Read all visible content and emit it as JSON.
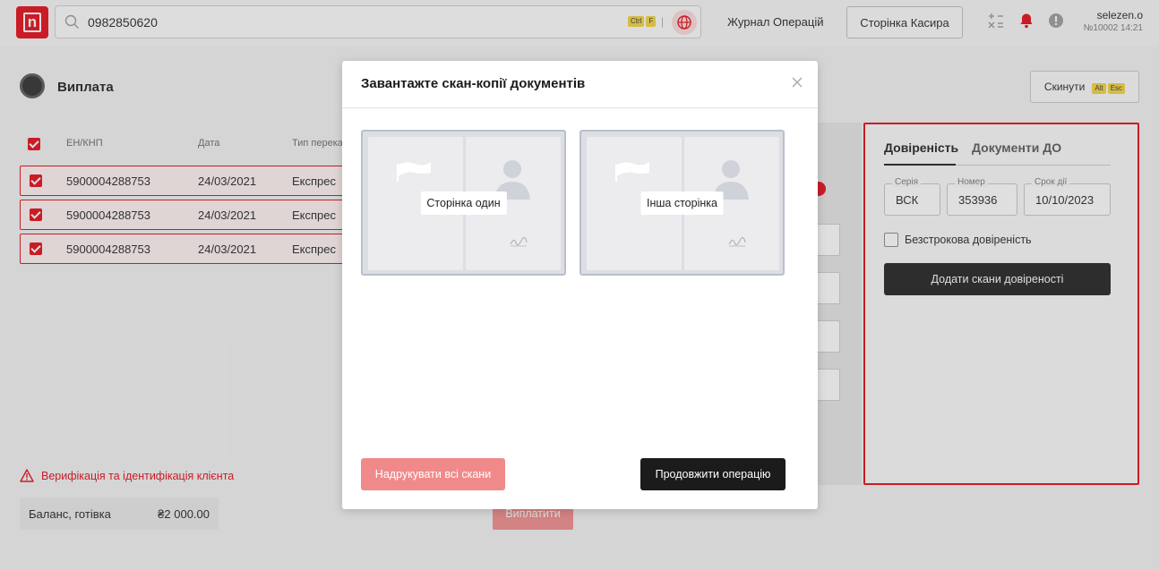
{
  "header": {
    "search_value": "0982850620",
    "shortcut_keys": [
      "Ctrl",
      "F"
    ],
    "journal_link": "Журнал Операцій",
    "cashier_button": "Сторінка Касира",
    "username": "selezen.o",
    "user_info": "№10002 14:21"
  },
  "page": {
    "title": "Виплата",
    "reset_button": "Скинути",
    "reset_keys": [
      "Alt",
      "Esc"
    ]
  },
  "table": {
    "headers": [
      "ЕН/КНП",
      "Дата",
      "Тип перека"
    ],
    "rows": [
      {
        "en": "5900004288753",
        "date": "24/03/2021",
        "type": "Експрес"
      },
      {
        "en": "5900004288753",
        "date": "24/03/2021",
        "type": "Експрес"
      },
      {
        "en": "5900004288753",
        "date": "24/03/2021",
        "type": "Експрес"
      }
    ]
  },
  "verification_warning": "Верифікація та ідентифікація клієнта",
  "balance": {
    "label": "Баланс, готівка",
    "value": "₴2 000.00"
  },
  "pay_button": "Виплатити",
  "power_of_attorney": {
    "tabs": [
      "Довіреність",
      "Документи ДО"
    ],
    "fields": [
      {
        "label": "Серія",
        "value": "ВСК"
      },
      {
        "label": "Номер",
        "value": "353936"
      },
      {
        "label": "Срок дії",
        "value": "10/10/2023"
      }
    ],
    "unlimited_label": "Безстрокова довіреність",
    "add_scans_button": "Додати скани довіреності"
  },
  "modal": {
    "title": "Завантажте скан-копії документів",
    "docs": [
      "Сторінка один",
      "Інша сторінка"
    ],
    "print_button": "Надрукувати всі скани",
    "continue_button": "Продовжити операцію"
  },
  "colors": {
    "accent": "#e30613",
    "dark": "#1b1b1b",
    "disabled_red": "#f08a8a"
  }
}
